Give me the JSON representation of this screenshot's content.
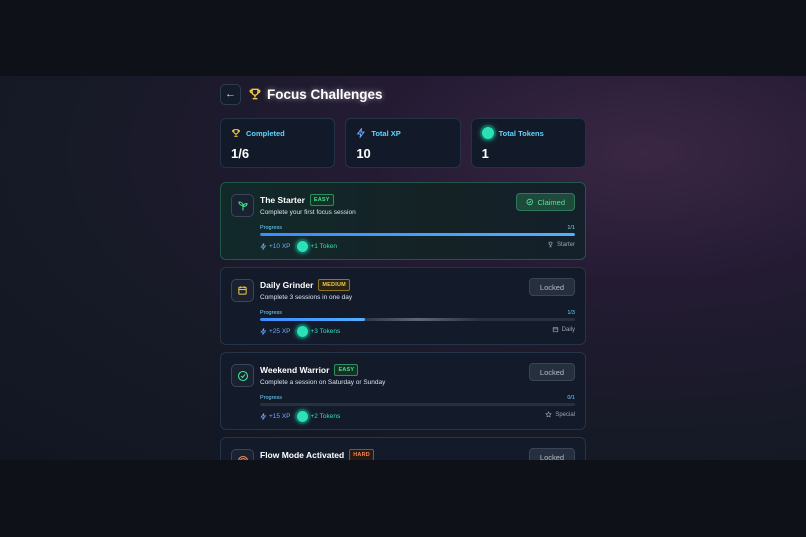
{
  "header": {
    "title": "Focus Challenges"
  },
  "stats": [
    {
      "label": "Completed",
      "value": "1/6",
      "icon": "trophy-icon"
    },
    {
      "label": "Total XP",
      "value": "10",
      "icon": "lightning-icon"
    },
    {
      "label": "Total Tokens",
      "value": "1",
      "icon": "token-icon"
    }
  ],
  "challenges": [
    {
      "title": "The Starter",
      "difficulty": "EASY",
      "description": "Complete your first focus session",
      "status": "Claimed",
      "progress_label": "Progress",
      "progress_text": "1/1",
      "progress": 1.0,
      "xp": "+10 XP",
      "tokens": "+1 Token",
      "category": "Starter",
      "icon": "seedling-icon"
    },
    {
      "title": "Daily Grinder",
      "difficulty": "MEDIUM",
      "description": "Complete 3 sessions in one day",
      "status": "Locked",
      "progress_label": "Progress",
      "progress_text": "1/3",
      "progress": 0.333,
      "xp": "+25 XP",
      "tokens": "+3 Tokens",
      "category": "Daily",
      "icon": "calendar-icon"
    },
    {
      "title": "Weekend Warrior",
      "difficulty": "EASY",
      "description": "Complete a session on Saturday or Sunday",
      "status": "Locked",
      "progress_label": "Progress",
      "progress_text": "0/1",
      "progress": 0,
      "xp": "+15 XP",
      "tokens": "+2 Tokens",
      "category": "Special",
      "icon": "check-circle-icon"
    },
    {
      "title": "Flow Mode Activated",
      "difficulty": "HARD",
      "description": "",
      "status": "Locked",
      "progress_label": "",
      "progress_text": "",
      "progress": 0,
      "xp": "",
      "tokens": "",
      "category": "",
      "icon": "target-icon"
    }
  ],
  "colors": {
    "accent": "#5fd6ff",
    "token": "#2de0b8",
    "xp": "#6fa8ff",
    "progress": "#3d8bff"
  }
}
